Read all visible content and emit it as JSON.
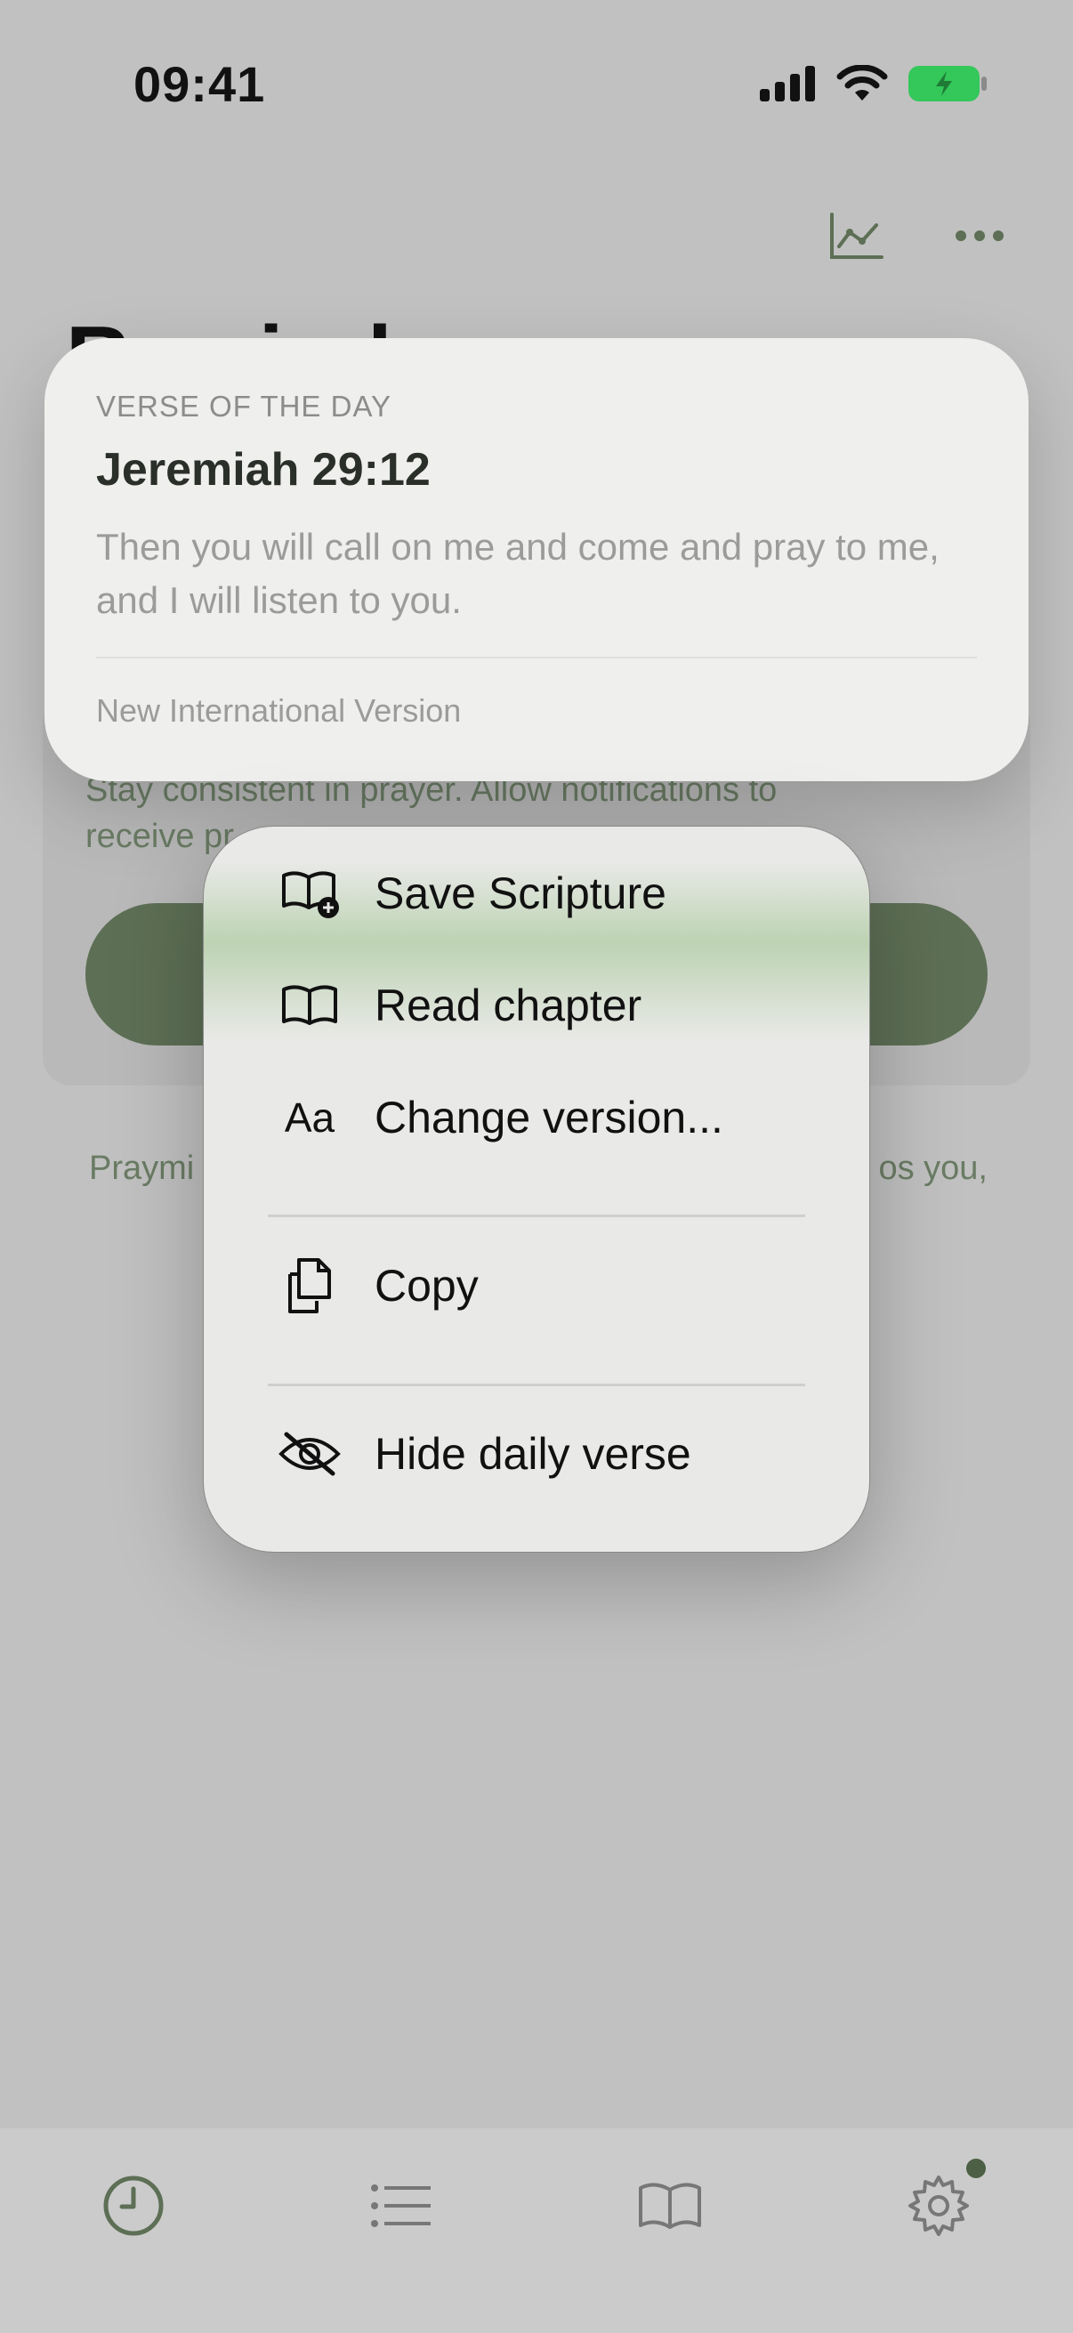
{
  "status_bar": {
    "time": "09:41"
  },
  "background": {
    "page_title": "Reminders",
    "reminder_text_line1": "Stay consistent in prayer. Allow notifications to",
    "reminder_text_line2": "receive pr",
    "footnote_left": "Praymi",
    "footnote_right": "os you,"
  },
  "verse_card": {
    "kicker": "VERSE OF THE DAY",
    "reference": "Jeremiah 29:12",
    "text": "Then you will call on me and come and pray to me, and I will listen to you.",
    "version": "New International Version"
  },
  "context_menu": {
    "items": [
      {
        "label": "Save Scripture",
        "icon": "book-plus-icon"
      },
      {
        "label": "Read chapter",
        "icon": "book-open-icon"
      },
      {
        "label": "Change version...",
        "icon": "text-size-icon",
        "icon_text": "Aa"
      },
      {
        "label": "Copy",
        "icon": "copy-icon"
      },
      {
        "label": "Hide daily verse",
        "icon": "eye-slash-icon"
      }
    ]
  },
  "tab_bar": {
    "tabs": [
      {
        "name": "clock",
        "icon": "clock-icon",
        "active": true
      },
      {
        "name": "list",
        "icon": "list-icon"
      },
      {
        "name": "bible",
        "icon": "book-icon"
      },
      {
        "name": "settings",
        "icon": "gear-icon",
        "badge": true
      }
    ]
  },
  "colors": {
    "accent": "#5d6f55",
    "battery": "#34c759",
    "menu_highlight": "#bad2b0"
  }
}
